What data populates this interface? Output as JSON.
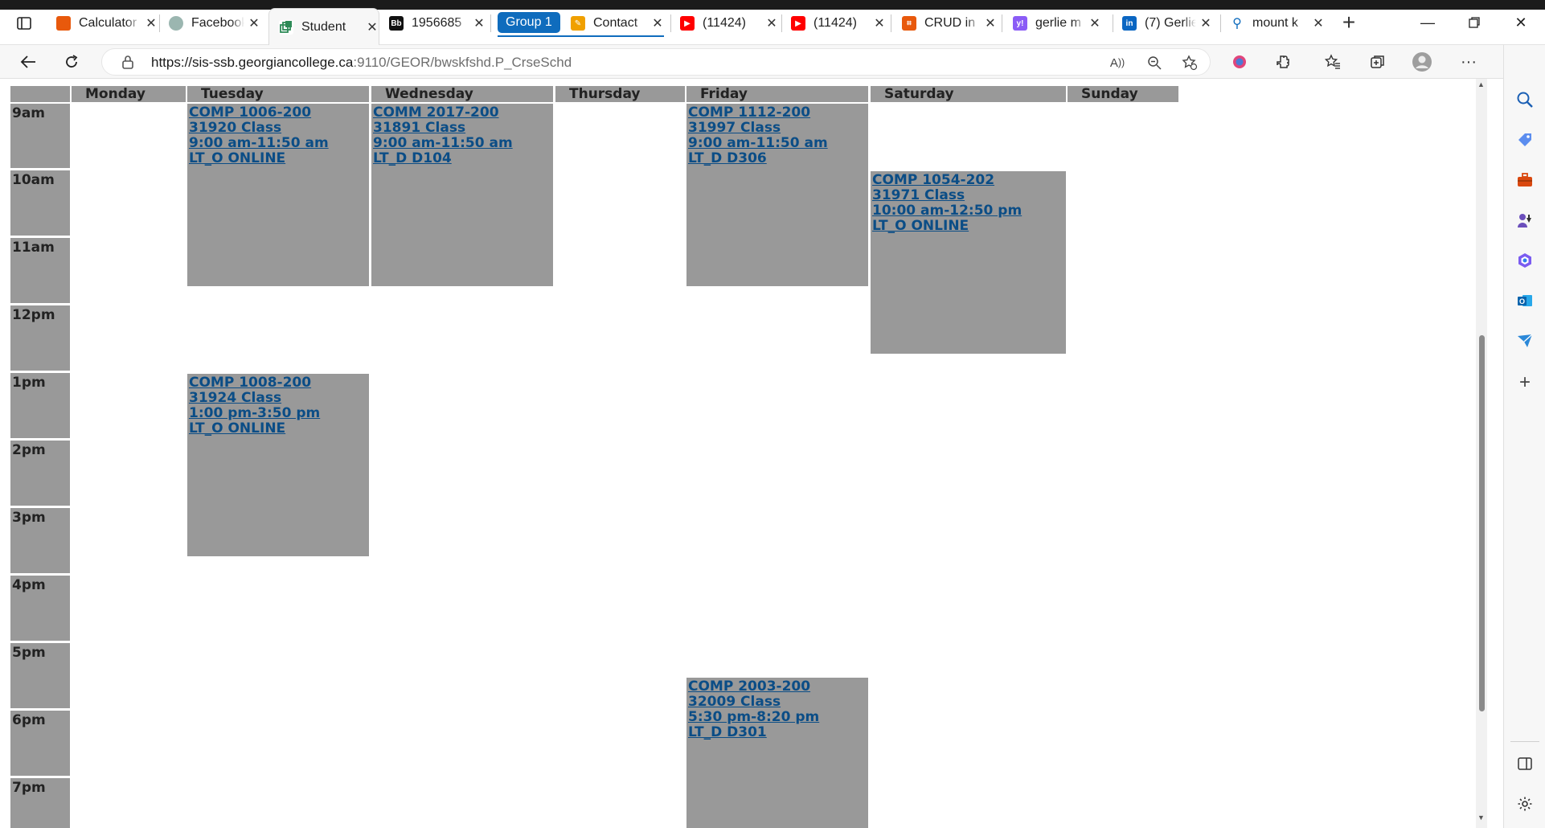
{
  "tabs": [
    {
      "title": "Calculator",
      "fav_color": "#e8590c"
    },
    {
      "title": "Facebook",
      "fav_color": "#9bb6b0"
    },
    {
      "title": "Student",
      "fav_color": "#2e8b57"
    },
    {
      "title": "1956685",
      "fav_color": "#111111",
      "fav_text": "Bb"
    },
    {
      "title": "Contact",
      "fav_color": "#f0a000"
    },
    {
      "title": "(11424)",
      "fav_color": "#ff0000"
    },
    {
      "title": "(11424)",
      "fav_color": "#ff0000"
    },
    {
      "title": "CRUD in",
      "fav_color": "#e8590c"
    },
    {
      "title": "gerlie m",
      "fav_color": "#8b5cf6",
      "fav_text": "y!"
    },
    {
      "title": "(7) Gerlie",
      "fav_color": "#0a66c2",
      "fav_text": "in"
    },
    {
      "title": "mount k",
      "fav_color": "#0f6cbd"
    }
  ],
  "tab_group": {
    "label": "Group 1"
  },
  "address": {
    "url_host": "https://sis-ssb.georgiancollege.ca",
    "url_path": ":9110/GEOR/bwskfshd.P_CrseSchd"
  },
  "schedule": {
    "days": [
      "Monday",
      "Tuesday",
      "Wednesday",
      "Thursday",
      "Friday",
      "Saturday",
      "Sunday"
    ],
    "times": [
      "9am",
      "10am",
      "11am",
      "12pm",
      "1pm",
      "2pm",
      "3pm",
      "4pm",
      "5pm",
      "6pm",
      "7pm"
    ],
    "classes": [
      {
        "course": "COMP 1006-200",
        "crn": "31920 Class",
        "time": "9:00 am-11:50 am",
        "location": "LT_O ONLINE"
      },
      {
        "course": "COMM 2017-200",
        "crn": "31891 Class",
        "time": "9:00 am-11:50 am",
        "location": "LT_D D104"
      },
      {
        "course": "COMP 1112-200",
        "crn": "31997 Class",
        "time": "9:00 am-11:50 am",
        "location": "LT_D D306"
      },
      {
        "course": "COMP 1054-202",
        "crn": "31971 Class",
        "time": "10:00 am-12:50 pm",
        "location": "LT_O ONLINE"
      },
      {
        "course": "COMP 1008-200",
        "crn": "31924 Class",
        "time": "1:00 pm-3:50 pm",
        "location": "LT_O ONLINE"
      },
      {
        "course": "COMP 2003-200",
        "crn": "32009 Class",
        "time": "5:30 pm-8:20 pm",
        "location": "LT_D D301"
      }
    ]
  }
}
